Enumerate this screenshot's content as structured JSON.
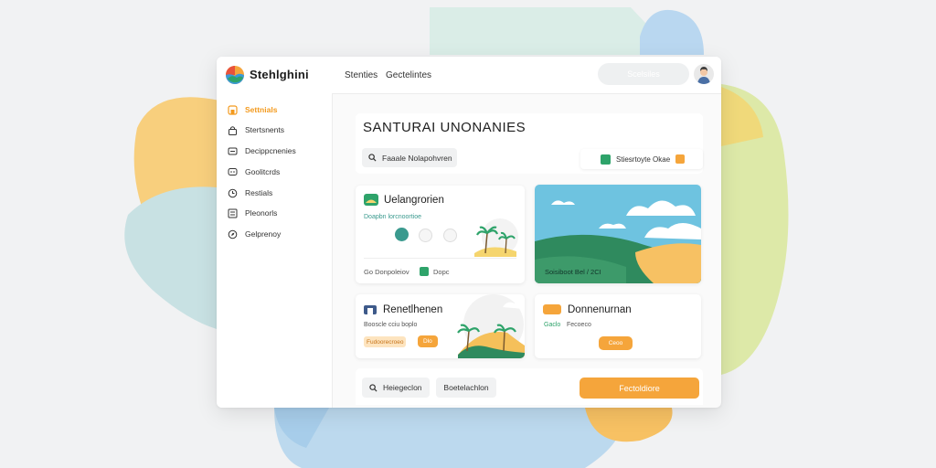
{
  "app": {
    "brand": "Stehlghini"
  },
  "topbar": {
    "nav": [
      "Stenties",
      "Gectelintes"
    ],
    "search_label": "Scelsiles"
  },
  "sidebar": {
    "items": [
      {
        "label": "Settnials",
        "icon": "home-icon"
      },
      {
        "label": "Stertsnents",
        "icon": "lock-icon"
      },
      {
        "label": "Decippcnenies",
        "icon": "card-icon"
      },
      {
        "label": "Goolitcrds",
        "icon": "chat-icon"
      },
      {
        "label": "Restials",
        "icon": "clock-icon"
      },
      {
        "label": "Pleonorls",
        "icon": "grid-icon"
      },
      {
        "label": "Gelprenoy",
        "icon": "compass-icon"
      }
    ]
  },
  "main": {
    "title": "SANTURAI UNONANIES",
    "search_chip": "Faaale Nolapohvren",
    "filter_chip": "Stiesrtoyte Okae",
    "cards": {
      "card1": {
        "title": "Uelangrorien",
        "subtitle": "Doapbn lorcnoortioe",
        "footer_left": "Go Donpoleiov",
        "footer_right": "Dopc"
      },
      "card2": {
        "caption": "Soisiboot Bel / 2CI"
      },
      "card3": {
        "title": "Renetlhenen",
        "subtitle": "Booscle cciu boplo",
        "tag": "Fudoorecroeo",
        "tag_small": "Dlo"
      },
      "card4": {
        "title": "Donnenurnan",
        "subtitle_a": "Gaclo",
        "subtitle_b": "Fecoeco",
        "button": "Ceoo"
      }
    },
    "bottom": {
      "chip1": "Heiegeclon",
      "chip2": "Boetelachlon",
      "cta": "Fectoldiore"
    }
  },
  "colors": {
    "accent_orange": "#f5a53b",
    "accent_green": "#2ea36a",
    "accent_teal": "#3a9a8e",
    "sky": "#6ec3e0"
  }
}
